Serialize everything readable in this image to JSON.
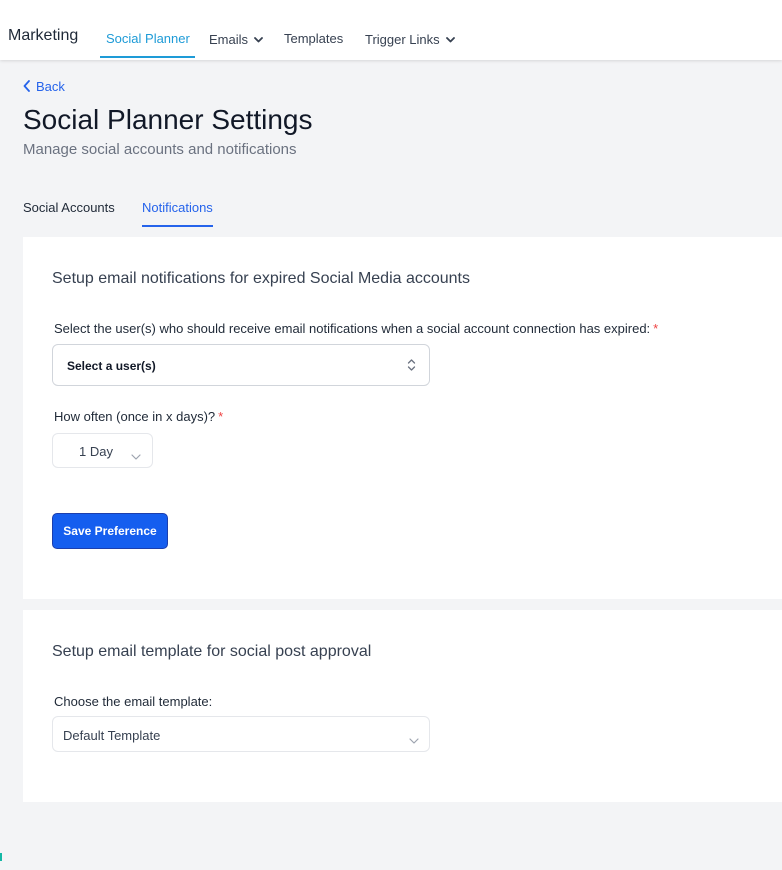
{
  "header": {
    "brand": "Marketing",
    "nav": [
      {
        "label": "Social Planner",
        "active": true,
        "dropdown": false
      },
      {
        "label": "Emails",
        "active": false,
        "dropdown": true
      },
      {
        "label": "Templates",
        "active": false,
        "dropdown": false
      },
      {
        "label": "Trigger Links",
        "active": false,
        "dropdown": true
      }
    ]
  },
  "page": {
    "back_label": "Back",
    "title": "Social Planner Settings",
    "subtitle": "Manage social accounts and notifications",
    "tabs": [
      {
        "label": "Social Accounts",
        "active": false
      },
      {
        "label": "Notifications",
        "active": true
      }
    ]
  },
  "expired_section": {
    "title": "Setup email notifications for expired Social Media accounts",
    "users_label": "Select the user(s) who should receive email notifications when a social account connection has expired:",
    "users_required_mark": "*",
    "users_placeholder": "Select a user(s)",
    "frequency_label": "How often (once in x days)?",
    "frequency_required_mark": "*",
    "frequency_value": "1 Day",
    "save_label": "Save Preference"
  },
  "approval_section": {
    "title": "Setup email template for social post approval",
    "template_label": "Choose the email template:",
    "template_value": "Default Template"
  },
  "colors": {
    "accent_nav": "#1e9bd7",
    "accent_primary": "#155eef",
    "link": "#2563eb",
    "required": "#ef4444",
    "background": "#f3f4f6"
  },
  "icons": {
    "back": "chevron-left-icon",
    "dropdown": "chevron-down-icon",
    "sort": "up-down-chevron-icon"
  }
}
